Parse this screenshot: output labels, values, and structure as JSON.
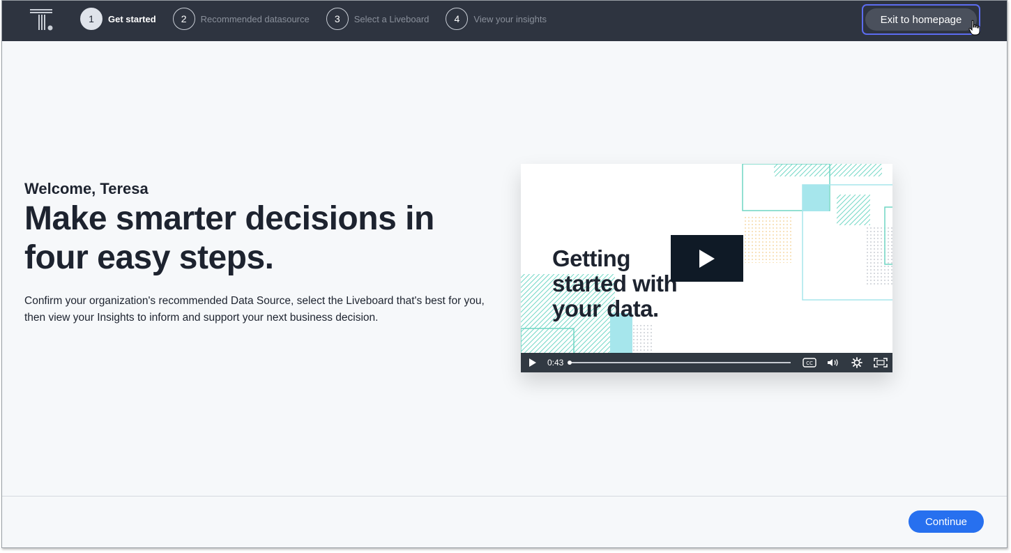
{
  "header": {
    "logo_icon": "thoughtspot-logo-icon",
    "steps": [
      {
        "number": "1",
        "label": "Get started",
        "active": true
      },
      {
        "number": "2",
        "label": "Recommended datasource",
        "active": false
      },
      {
        "number": "3",
        "label": "Select a Liveboard",
        "active": false
      },
      {
        "number": "4",
        "label": "View your insights",
        "active": false
      }
    ],
    "exit_label": "Exit to homepage"
  },
  "main": {
    "welcome": "Welcome, Teresa",
    "headline": "Make smarter decisions in four easy steps.",
    "description": "Confirm your organization's recommended Data Source, select the Liveboard that's best for you, then view your Insights to inform and support your next business decision."
  },
  "video": {
    "title": "Getting started with your data.",
    "time": "0:43",
    "progress": 0
  },
  "footer": {
    "continue_label": "Continue"
  },
  "colors": {
    "topbar": "#2e3440",
    "accent": "#2770ef",
    "focus_ring": "#5c6cf0",
    "teal": "#6fd6c4",
    "cyan": "#a6e6ec"
  }
}
